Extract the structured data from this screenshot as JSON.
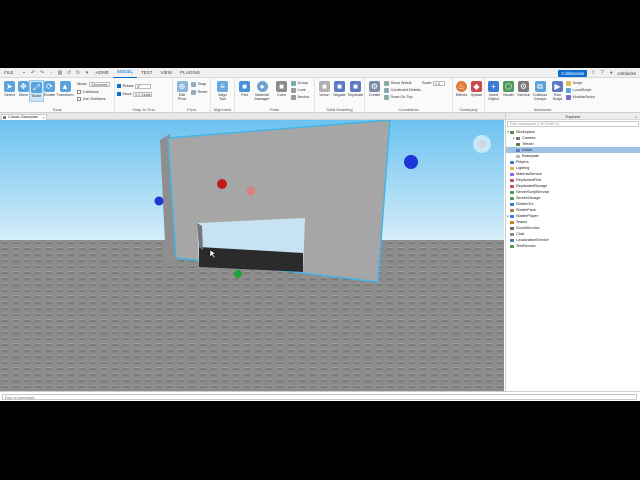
{
  "menubar": {
    "file_label": "FILE",
    "tabs": [
      {
        "label": "HOME"
      },
      {
        "label": "MODEL"
      },
      {
        "label": "TEST"
      },
      {
        "label": "VIEW"
      },
      {
        "label": "PLUGINS"
      }
    ],
    "active_tab": "MODEL",
    "collaborate_label": "Collaborate",
    "username": "cmblocks"
  },
  "ribbon": {
    "tools": {
      "label": "Tools",
      "buttons": [
        {
          "label": "Select"
        },
        {
          "label": "Move"
        },
        {
          "label": "Scale"
        },
        {
          "label": "Rotate"
        },
        {
          "label": "Transform"
        }
      ],
      "mode_label": "Mode:",
      "mode_value": "Geometric",
      "collisions_label": "Collisions",
      "join_surfaces_label": "Join Surfaces"
    },
    "snap": {
      "label": "Snap to Grid",
      "rotate_label": "Rotate",
      "rotate_value": "5°",
      "move_label": "Move",
      "move_value": "0.2 Studs"
    },
    "pivot": {
      "label": "Pivot",
      "edit_pivot_label": "Edit Pivot",
      "snap_label": "Snap",
      "reset_label": "Reset"
    },
    "alignment": {
      "label": "Alignment",
      "align_tool_label": "Align Tool"
    },
    "parts": {
      "label": "Parts",
      "part_label": "Part",
      "material_manager_label": "Material Manager",
      "color_label": "Color",
      "group_label": "Group",
      "lock_label": "Lock",
      "anchor_label": "Anchor"
    },
    "solid": {
      "label": "Solid Modeling",
      "union_label": "Union",
      "negate_label": "Negate",
      "separate_label": "Separate"
    },
    "constraints": {
      "label": "Constraints",
      "create_label": "Create",
      "show_welds_label": "Show Welds",
      "constraint_details_label": "Constraint Details",
      "draw_on_top_label": "Draw On Top",
      "scale_label": "Scale",
      "scale_value": "1.0"
    },
    "gameplay": {
      "label": "Gameplay",
      "effects_label": "Effects",
      "spawn_label": "Spawn"
    },
    "advanced": {
      "label": "Advanced",
      "insert_object_label": "Insert Object",
      "model_label": "Model",
      "service_label": "Service",
      "collision_groups_label": "Collision Groups",
      "run_script_label": "Run Script",
      "script_label": "Script",
      "localscript_label": "LocalScript",
      "modulescript_label": "ModuleScript"
    }
  },
  "document_tab": {
    "label": "Classic Baseplate"
  },
  "explorer": {
    "title": "Explorer",
    "search_placeholder": "Filter workspace (Ctrl+Shift+X)",
    "items": [
      {
        "label": "Workspace",
        "depth": 0,
        "expanded": true,
        "icon_color": "#4a8f3c",
        "selected": false,
        "has_arrow": true
      },
      {
        "label": "Camera",
        "depth": 1,
        "expanded": false,
        "icon_color": "#7a7a7a",
        "selected": false,
        "has_arrow": true
      },
      {
        "label": "Terrain",
        "depth": 1,
        "expanded": false,
        "icon_color": "#4c8a3a",
        "selected": false,
        "has_arrow": false
      },
      {
        "label": "Union",
        "depth": 1,
        "expanded": false,
        "icon_color": "#5f79c5",
        "selected": true,
        "has_arrow": false
      },
      {
        "label": "Baseplate",
        "depth": 1,
        "expanded": false,
        "icon_color": "#b8b8b8",
        "selected": false,
        "has_arrow": false
      },
      {
        "label": "Players",
        "depth": 0,
        "expanded": false,
        "icon_color": "#3b7bd4",
        "selected": false,
        "has_arrow": false
      },
      {
        "label": "Lighting",
        "depth": 0,
        "expanded": false,
        "icon_color": "#e3b62c",
        "selected": false,
        "has_arrow": false
      },
      {
        "label": "MaterialService",
        "depth": 0,
        "expanded": false,
        "icon_color": "#8a6ad0",
        "selected": false,
        "has_arrow": false
      },
      {
        "label": "ReplicatedFirst",
        "depth": 0,
        "expanded": false,
        "icon_color": "#cf4f4f",
        "selected": false,
        "has_arrow": false
      },
      {
        "label": "ReplicatedStorage",
        "depth": 0,
        "expanded": false,
        "icon_color": "#cf4f4f",
        "selected": false,
        "has_arrow": false
      },
      {
        "label": "ServerScriptService",
        "depth": 0,
        "expanded": false,
        "icon_color": "#4c9a5c",
        "selected": false,
        "has_arrow": false
      },
      {
        "label": "ServerStorage",
        "depth": 0,
        "expanded": false,
        "icon_color": "#4c9a5c",
        "selected": false,
        "has_arrow": false
      },
      {
        "label": "StarterGui",
        "depth": 0,
        "expanded": false,
        "icon_color": "#3b7bd4",
        "selected": false,
        "has_arrow": false
      },
      {
        "label": "StarterPack",
        "depth": 0,
        "expanded": false,
        "icon_color": "#b07b3a",
        "selected": false,
        "has_arrow": false
      },
      {
        "label": "StarterPlayer",
        "depth": 0,
        "expanded": false,
        "icon_color": "#3b7bd4",
        "selected": false,
        "has_arrow": true
      },
      {
        "label": "Teams",
        "depth": 0,
        "expanded": false,
        "icon_color": "#d07a2c",
        "selected": false,
        "has_arrow": false
      },
      {
        "label": "SoundService",
        "depth": 0,
        "expanded": false,
        "icon_color": "#6a6a6a",
        "selected": false,
        "has_arrow": false
      },
      {
        "label": "Chat",
        "depth": 0,
        "expanded": false,
        "icon_color": "#8a8a8a",
        "selected": false,
        "has_arrow": false
      },
      {
        "label": "LocalizationService",
        "depth": 0,
        "expanded": false,
        "icon_color": "#3b7bd4",
        "selected": false,
        "has_arrow": false
      },
      {
        "label": "TestService",
        "depth": 0,
        "expanded": false,
        "icon_color": "#4c9a5c",
        "selected": false,
        "has_arrow": false
      }
    ]
  },
  "command_bar": {
    "placeholder": "Run a command"
  },
  "colors": {
    "accent": "#0a6ed1",
    "selection": "#9cc3e6",
    "sky_top": "#6fc4f0",
    "sky_bottom": "#d9f0fb",
    "baseplate": "#8a8a8a",
    "wall": "#a6a6a6",
    "selection_outline": "#3fb5e8"
  }
}
